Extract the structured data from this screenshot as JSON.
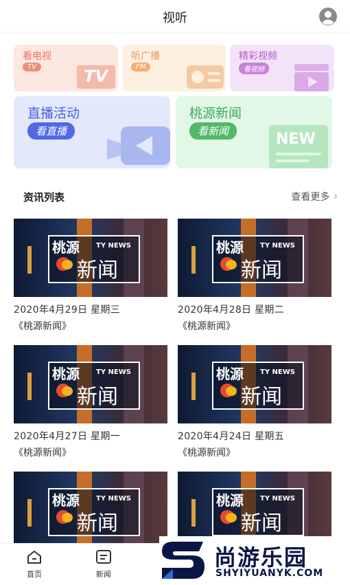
{
  "header": {
    "title": "视听",
    "user_icon": "user-circle-icon"
  },
  "cards": {
    "tv": {
      "title": "看电视",
      "badge": "TV",
      "deco_text": "TV"
    },
    "fm": {
      "title": "听广播",
      "badge": "FM"
    },
    "video": {
      "title": "精彩视频",
      "badge": "看视频"
    },
    "live": {
      "title": "直播活动",
      "badge": "看直播"
    },
    "news": {
      "title": "桃源新闻",
      "badge": "看新闻",
      "deco_text": "NEW"
    }
  },
  "section": {
    "title": "资讯列表",
    "more": "查看更多"
  },
  "thumb": {
    "name": "桃源",
    "tag": "TY NEWS",
    "word": "新闻"
  },
  "news_items": [
    {
      "date": "2020年4月29日   星期三",
      "program": "《桃源新闻》"
    },
    {
      "date": "2020年4月28日   星期二",
      "program": "《桃源新闻》"
    },
    {
      "date": "2020年4月27日   星期一",
      "program": "《桃源新闻》"
    },
    {
      "date": "2020年4月24日   星期五",
      "program": "《桃源新闻》"
    },
    {
      "date": "",
      "program": ""
    },
    {
      "date": "",
      "program": ""
    }
  ],
  "tabbar": {
    "home": "首页",
    "news": "新闻"
  },
  "watermark": {
    "name": "尚游乐园",
    "url": "SHYIYUANYK.COM"
  },
  "colors": {
    "accent_blue": "#5069e6",
    "accent_green": "#51b967",
    "brand_navy": "#0a1746"
  }
}
